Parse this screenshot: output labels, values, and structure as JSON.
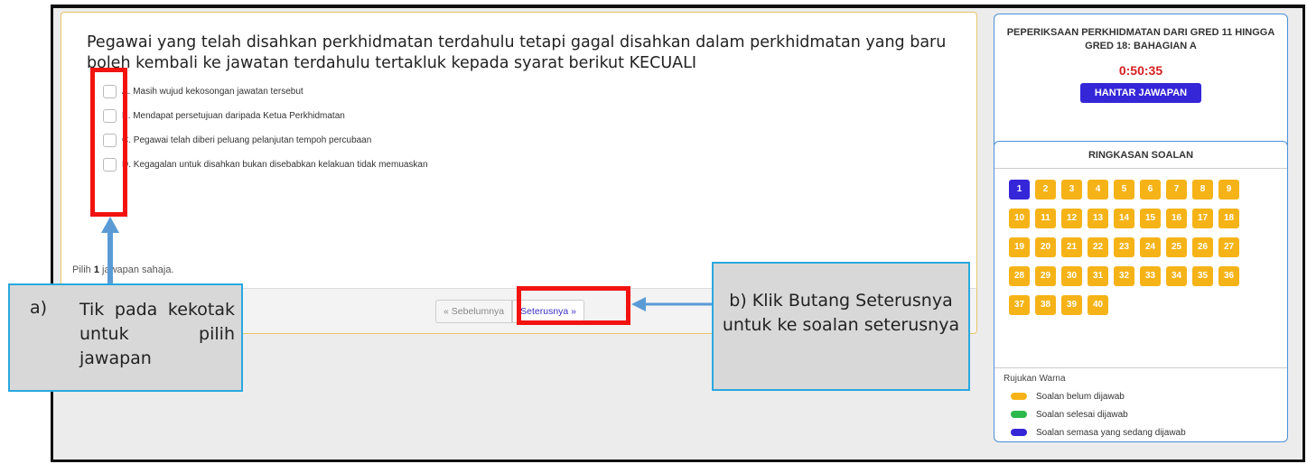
{
  "question": {
    "text": "Pegawai yang telah disahkan perkhidmatan terdahulu tetapi gagal disahkan dalam perkhidmatan yang baru boleh kembali ke jawatan terdahulu tertakluk kepada syarat berikut KECUALI",
    "options": [
      "A. Masih wujud kekosongan jawatan tersebut",
      "B. Mendapat persetujuan daripada Ketua Perkhidmatan",
      "C. Pegawai telah diberi peluang pelanjutan tempoh percubaan",
      "D. Kegagalan untuk disahkan bukan disebabkan kelakuan tidak memuaskan"
    ],
    "hint_prefix": "Pilih ",
    "hint_count": "1",
    "hint_suffix": " jawapan sahaja.",
    "prev_label": "« Sebelumnya",
    "next_label": "Seterusnya »"
  },
  "exam": {
    "title": "PEPERIKSAAN PERKHIDMATAN DARI GRED 11 HINGGA GRED 18: BAHAGIAN A",
    "timer": "0:50:35",
    "submit_label": "HANTAR JAWAPAN"
  },
  "summary": {
    "title": "RINGKASAN SOALAN",
    "current": "1",
    "numbers": [
      "1",
      "2",
      "3",
      "4",
      "5",
      "6",
      "7",
      "8",
      "9",
      "10",
      "11",
      "12",
      "13",
      "14",
      "15",
      "16",
      "17",
      "18",
      "19",
      "20",
      "21",
      "22",
      "23",
      "24",
      "25",
      "26",
      "27",
      "28",
      "29",
      "30",
      "31",
      "32",
      "33",
      "34",
      "35",
      "36",
      "37",
      "38",
      "39",
      "40"
    ]
  },
  "legend": {
    "title": "Rujukan Warna",
    "items": [
      {
        "label": "Soalan belum dijawab",
        "color": "#f5b317"
      },
      {
        "label": "Soalan selesai dijawab",
        "color": "#2db84d"
      },
      {
        "label": "Soalan semasa yang sedang dijawab",
        "color": "#3526d8"
      }
    ]
  },
  "annotations": {
    "a_label": "a)",
    "a_text": "Tik pada kekotak untuk pilih jawapan",
    "b_text": "b) Klik Butang Seterusnya untuk ke soalan seterusnya"
  },
  "colors": {
    "accent": "#3526d8",
    "pending": "#f5b317",
    "timer": "#d62020",
    "highlight": "#f2130f",
    "callout_border": "#29a8e0"
  }
}
